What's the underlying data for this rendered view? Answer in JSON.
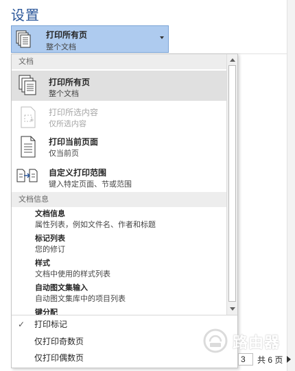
{
  "settings": {
    "title": "设置"
  },
  "print_range": {
    "selected_title": "打印所有页",
    "selected_subtitle": "整个文档"
  },
  "menu": {
    "document_header": "文档",
    "document_items": [
      {
        "title": "打印所有页",
        "subtitle": "整个文档",
        "icon": "pages-stack-icon"
      },
      {
        "title": "打印所选内容",
        "subtitle": "仅所选内容",
        "icon": "selection-page-icon"
      },
      {
        "title": "打印当前页面",
        "subtitle": "仅当前页",
        "icon": "single-page-icon"
      },
      {
        "title": "自定义打印范围",
        "subtitle": "键入特定页面、节或范围",
        "icon": "custom-range-icon"
      }
    ],
    "info_header": "文档信息",
    "info_items": [
      {
        "title": "文档信息",
        "subtitle": "属性列表，例如文件名、作者和标题"
      },
      {
        "title": "标记列表",
        "subtitle": "您的修订"
      },
      {
        "title": "样式",
        "subtitle": "文档中使用的样式列表"
      },
      {
        "title": "自动图文集输入",
        "subtitle": "自动图文集库中的项目列表"
      },
      {
        "title": "键分配",
        "subtitle": ""
      }
    ],
    "options": [
      {
        "label": "打印标记",
        "checked": "✓"
      },
      {
        "label": "仅打印奇数页",
        "checked": ""
      },
      {
        "label": "仅打印偶数页",
        "checked": ""
      }
    ]
  },
  "pager": {
    "current_page": "3",
    "total_label": "共 6 页"
  },
  "watermark": {
    "text": "路由器"
  },
  "colors": {
    "accent": "#2b579a",
    "selection": "#aecbef",
    "hover": "#e0e0e0"
  }
}
